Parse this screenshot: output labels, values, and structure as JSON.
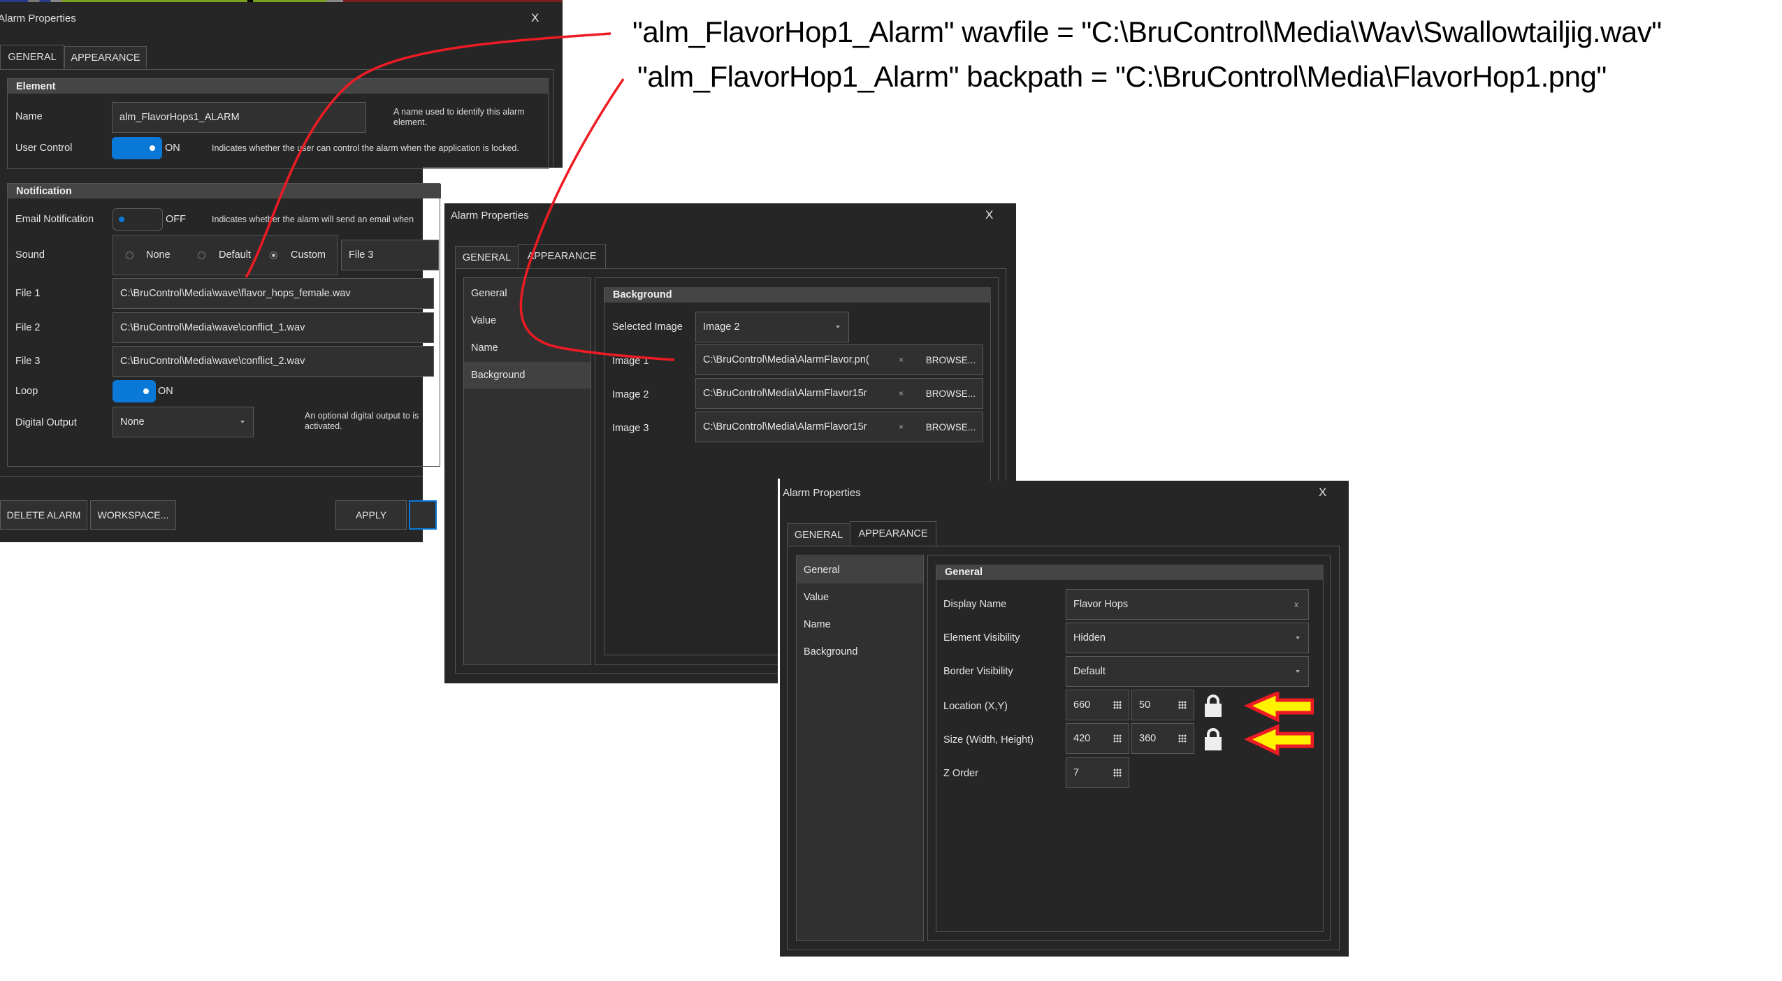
{
  "annotations": {
    "line1": "\"alm_FlavorHop1_Alarm\" wavfile = \"C:\\BruControl\\Media\\Wav\\Swallowtailjig.wav\"",
    "line2": "\"alm_FlavorHop1_Alarm\" backpath = \"C:\\BruControl\\Media\\FlavorHop1.png\""
  },
  "dialog1": {
    "title": "Alarm Properties",
    "close": "X",
    "tabs": [
      "GENERAL",
      "APPEARANCE"
    ],
    "active_tab": "GENERAL",
    "element_section": {
      "header": "Element",
      "name_label": "Name",
      "name_value": "alm_FlavorHops1_ALARM",
      "name_hint": "A name used to identify this alarm element.",
      "user_control_label": "User Control",
      "user_control_state": "ON",
      "user_control_hint": "Indicates whether the user can control the alarm when the application is locked."
    },
    "notification_section": {
      "header": "Notification",
      "email_label": "Email Notification",
      "email_state": "OFF",
      "email_hint": "Indicates whether the alarm will send an email when",
      "sound_label": "Sound",
      "sound_options": [
        "None",
        "Default",
        "Custom"
      ],
      "sound_selected": "Custom",
      "sound_file_select": "File 3",
      "file1_label": "File 1",
      "file1_value": "C:\\BruControl\\Media\\wave\\flavor_hops_female.wav",
      "file2_label": "File 2",
      "file2_value": "C:\\BruControl\\Media\\wave\\conflict_1.wav",
      "file3_label": "File 3",
      "file3_value": "C:\\BruControl\\Media\\wave\\conflict_2.wav",
      "loop_label": "Loop",
      "loop_state": "ON",
      "digital_output_label": "Digital Output",
      "digital_output_value": "None",
      "digital_output_hint": "An optional digital output to is activated."
    },
    "buttons": {
      "delete": "DELETE ALARM",
      "workspace": "WORKSPACE...",
      "apply": "APPLY"
    }
  },
  "dialog2": {
    "title": "Alarm Properties",
    "close": "X",
    "tabs": [
      "GENERAL",
      "APPEARANCE"
    ],
    "active_tab": "APPEARANCE",
    "side_items": [
      "General",
      "Value",
      "Name",
      "Background"
    ],
    "active_side_item": "Background",
    "section_header": "Background",
    "selected_image_label": "Selected Image",
    "selected_image_value": "Image 2",
    "images": [
      {
        "label": "Image 1",
        "value": "C:\\BruControl\\Media\\AlarmFlavor.pn(",
        "clear": "×",
        "browse": "BROWSE..."
      },
      {
        "label": "Image 2",
        "value": "C:\\BruControl\\Media\\AlarmFlavor15r",
        "clear": "×",
        "browse": "BROWSE..."
      },
      {
        "label": "Image 3",
        "value": "C:\\BruControl\\Media\\AlarmFlavor15r",
        "clear": "×",
        "browse": "BROWSE..."
      }
    ]
  },
  "dialog3": {
    "title": "Alarm Properties",
    "close": "X",
    "tabs": [
      "GENERAL",
      "APPEARANCE"
    ],
    "active_tab": "APPEARANCE",
    "side_items": [
      "General",
      "Value",
      "Name",
      "Background"
    ],
    "active_side_item": "General",
    "section_header": "General",
    "display_name_label": "Display Name",
    "display_name_value": "Flavor Hops",
    "display_name_clear": "x",
    "element_visibility_label": "Element Visibility",
    "element_visibility_value": "Hidden",
    "border_visibility_label": "Border Visibility",
    "border_visibility_value": "Default",
    "location_label": "Location (X,Y)",
    "location_x": "660",
    "location_y": "50",
    "size_label": "Size (Width, Height)",
    "size_w": "420",
    "size_h": "360",
    "z_order_label": "Z Order",
    "z_order_value": "7"
  },
  "colors": {
    "accent_blue": "#0a78d7",
    "annotation_red": "#ed1c24",
    "arrow_yellow": "#fff200",
    "dialog_bg": "#262626"
  }
}
